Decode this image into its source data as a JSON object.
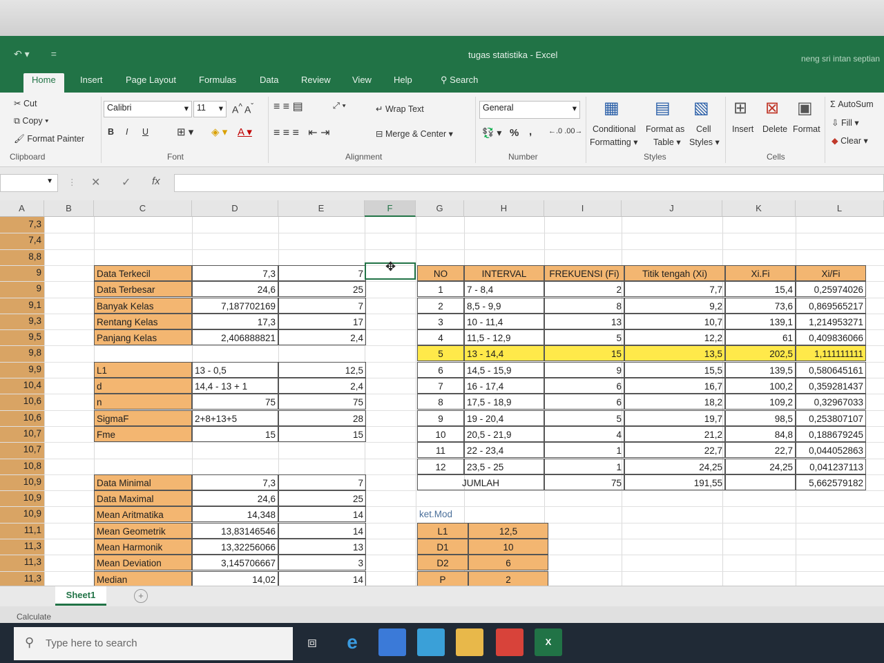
{
  "window": {
    "title": "tugas statistika  -  Excel",
    "user": "neng sri intan septian"
  },
  "tabs": [
    "Home",
    "Insert",
    "Page Layout",
    "Formulas",
    "Data",
    "Review",
    "View",
    "Help"
  ],
  "tab_search": "Search",
  "ribbon": {
    "clipboard": {
      "cut": "Cut",
      "copy": "Copy",
      "format_painter": "Format Painter",
      "group": "Clipboard"
    },
    "font": {
      "name": "Calibri",
      "size": "11",
      "group": "Font",
      "bold": "B",
      "italic": "I",
      "underline": "U"
    },
    "alignment": {
      "wrap": "Wrap Text",
      "merge": "Merge & Center",
      "group": "Alignment"
    },
    "number": {
      "format": "General",
      "percent": "%",
      "comma": ",",
      "group": "Number"
    },
    "styles": {
      "conditional": "Conditional",
      "conditional2": "Formatting",
      "format_as": "Format as",
      "format_as2": "Table",
      "cell_styles": "Cell",
      "cell_styles2": "Styles",
      "group": "Styles"
    },
    "cells": {
      "insert": "Insert",
      "delete": "Delete",
      "format": "Format",
      "group": "Cells"
    },
    "editing": {
      "autosum": "AutoSum",
      "fill": "Fill",
      "clear": "Clear"
    }
  },
  "columns": [
    "A",
    "B",
    "C",
    "D",
    "E",
    "F",
    "G",
    "H",
    "I",
    "J",
    "K",
    "L"
  ],
  "colA_values": [
    "7,3",
    "7,4",
    "8,8",
    "9",
    "9",
    "9,1",
    "9,3",
    "9,5",
    "9,8",
    "9,9",
    "10,4",
    "10,6",
    "10,6",
    "10,7",
    "10,7",
    "10,8",
    "10,9",
    "10,9",
    "10,9",
    "11,1",
    "11,3",
    "11,3",
    "11,3"
  ],
  "summary1": [
    [
      "Data Terkecil",
      "7,3",
      "7"
    ],
    [
      "Data Terbesar",
      "24,6",
      "25"
    ],
    [
      "Banyak Kelas",
      "7,187702169",
      "7"
    ],
    [
      "Rentang Kelas",
      "17,3",
      "17"
    ],
    [
      "Panjang Kelas",
      "2,406888821",
      "2,4"
    ]
  ],
  "summary2": [
    [
      "L1",
      "13 - 0,5",
      "12,5"
    ],
    [
      "d",
      "14,4 - 13 + 1",
      "2,4"
    ],
    [
      "n",
      "75",
      "75"
    ],
    [
      "SigmaF",
      "2+8+13+5",
      "28"
    ],
    [
      "Fme",
      "15",
      "15"
    ]
  ],
  "summary3": [
    [
      "Data Minimal",
      "7,3",
      "7"
    ],
    [
      "Data Maximal",
      "24,6",
      "25"
    ],
    [
      "Mean Aritmatika",
      "14,348",
      "14"
    ],
    [
      "Mean Geometrik",
      "13,83146546",
      "14"
    ],
    [
      "Mean Harmonik",
      "13,32256066",
      "13"
    ],
    [
      "Mean Deviation",
      "3,145706667",
      "3"
    ],
    [
      "Median",
      "14,02",
      "14"
    ]
  ],
  "freq_headers": [
    "NO",
    "INTERVAL",
    "FREKUENSI (Fi)",
    "Titik tengah (Xi)",
    "Xi.Fi",
    "Xi/Fi"
  ],
  "freq_rows": [
    [
      "1",
      "7 - 8,4",
      "2",
      "7,7",
      "15,4",
      "0,25974026"
    ],
    [
      "2",
      "8,5 - 9,9",
      "8",
      "9,2",
      "73,6",
      "0,869565217"
    ],
    [
      "3",
      "10 - 11,4",
      "13",
      "10,7",
      "139,1",
      "1,214953271"
    ],
    [
      "4",
      "11,5 - 12,9",
      "5",
      "12,2",
      "61",
      "0,409836066"
    ],
    [
      "5",
      "13 - 14,4",
      "15",
      "13,5",
      "202,5",
      "1,111111111"
    ],
    [
      "6",
      "14,5 - 15,9",
      "9",
      "15,5",
      "139,5",
      "0,580645161"
    ],
    [
      "7",
      "16 - 17,4",
      "6",
      "16,7",
      "100,2",
      "0,359281437"
    ],
    [
      "8",
      "17,5 - 18,9",
      "6",
      "18,2",
      "109,2",
      "0,32967033"
    ],
    [
      "9",
      "19 - 20,4",
      "5",
      "19,7",
      "98,5",
      "0,253807107"
    ],
    [
      "10",
      "20,5 - 21,9",
      "4",
      "21,2",
      "84,8",
      "0,188679245"
    ],
    [
      "11",
      "22 - 23,4",
      "1",
      "22,7",
      "22,7",
      "0,044052863"
    ],
    [
      "12",
      "23,5 - 25",
      "1",
      "24,25",
      "24,25",
      "0,041237113"
    ]
  ],
  "freq_total": [
    "JUMLAH",
    "75",
    "191,55",
    "",
    "5,662579182"
  ],
  "mod_label": "ket.Mod",
  "mod_rows": [
    [
      "L1",
      "12,5"
    ],
    [
      "D1",
      "10"
    ],
    [
      "D2",
      "6"
    ],
    [
      "P",
      "2"
    ]
  ],
  "sheet": "Sheet1",
  "status": "Calculate",
  "taskbar_search": "Type here to search"
}
